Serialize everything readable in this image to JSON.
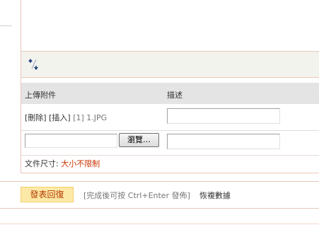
{
  "attachments": {
    "header": {
      "upload_label": "上傳附件",
      "description_label": "描述"
    },
    "file_row": {
      "delete_link": "[刪除]",
      "insert_link": "[插入]",
      "index": "[1]",
      "filename": "1.JPG"
    },
    "upload_row": {
      "browse_label": "瀏覽…"
    },
    "size_row": {
      "label": "文件尺寸:",
      "value": "大小不限制"
    }
  },
  "footer": {
    "submit_label": "發表回復",
    "hint": "[完成後可按 Ctrl+Enter 發佈]",
    "restore_label": "恢複數據"
  },
  "colors": {
    "panel_border": "#e6c8b8",
    "header_bg": "#e4e4e4",
    "submit_bg": "#fde9a7",
    "submit_text": "#b33a00",
    "limit_value": "#cc3300"
  },
  "icons": {
    "resize": "resize-toggle-icon"
  }
}
